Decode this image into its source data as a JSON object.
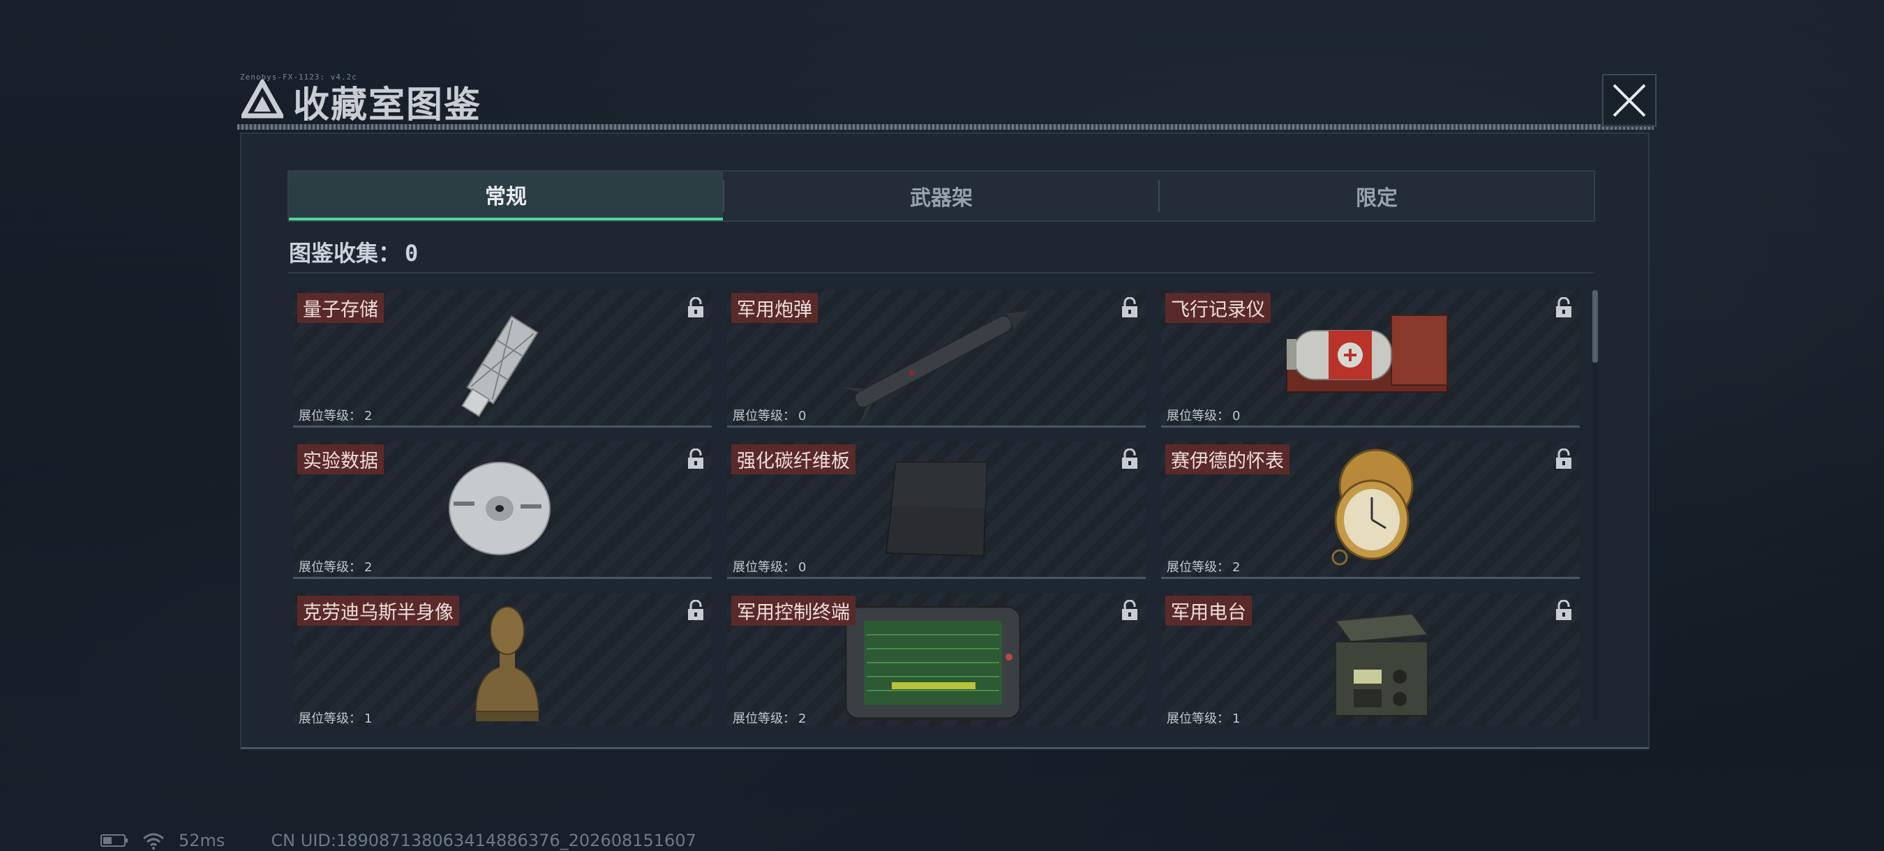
{
  "header": {
    "tiny_text": "Zenobys-FX-1123: v4.2c",
    "title": "收藏室图鉴"
  },
  "tabs": [
    {
      "label": "常规",
      "active": true
    },
    {
      "label": "武器架",
      "active": false
    },
    {
      "label": "限定",
      "active": false
    }
  ],
  "collection": {
    "label": "图鉴收集：",
    "value": "0"
  },
  "level_label": "展位等级：",
  "items": [
    {
      "name": "量子存储",
      "level": "2",
      "icon": "usb-drive-icon"
    },
    {
      "name": "军用炮弹",
      "level": "0",
      "icon": "missile-icon"
    },
    {
      "name": "飞行记录仪",
      "level": "0",
      "icon": "flight-recorder-icon"
    },
    {
      "name": "实验数据",
      "level": "2",
      "icon": "disc-icon"
    },
    {
      "name": "强化碳纤维板",
      "level": "0",
      "icon": "carbon-plate-icon"
    },
    {
      "name": "赛伊德的怀表",
      "level": "2",
      "icon": "pocket-watch-icon"
    },
    {
      "name": "克劳迪乌斯半身像",
      "level": "1",
      "icon": "bust-icon"
    },
    {
      "name": "军用控制终端",
      "level": "2",
      "icon": "control-terminal-icon"
    },
    {
      "name": "军用电台",
      "level": "1",
      "icon": "radio-icon"
    }
  ],
  "status_bar": {
    "ping": "52ms",
    "uid": "CN UID:189087138063414886376_202608151607"
  },
  "colors": {
    "accent_green": "#4fd49b",
    "name_tag_bg": "#5a2a2a",
    "panel_bg": "#1e2631"
  }
}
